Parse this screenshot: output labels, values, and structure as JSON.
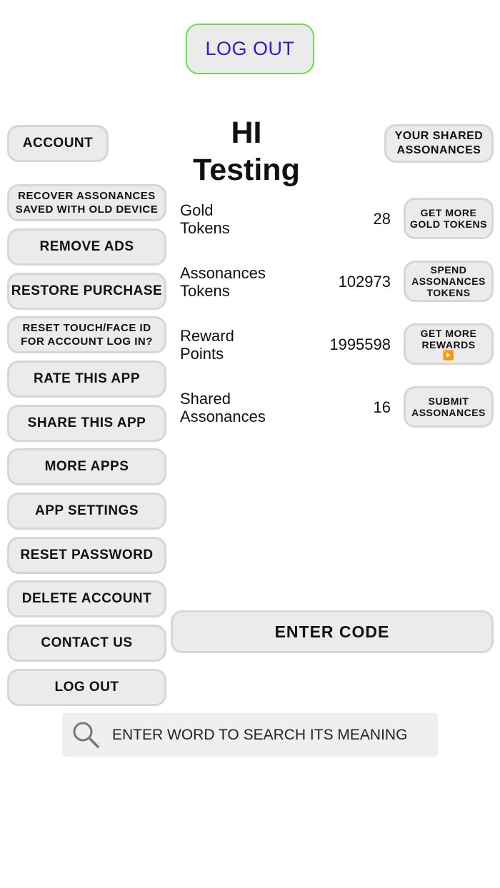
{
  "top_logout_label": "LOG OUT",
  "account_label": "ACCOUNT",
  "greeting": {
    "line1": "HI",
    "line2": "Testing"
  },
  "shared_assonances_button": {
    "line1": "YOUR SHARED",
    "line2": "ASSONANCES"
  },
  "sidebar": {
    "recover": {
      "line1": "RECOVER ASSONANCES",
      "line2": "SAVED WITH OLD DEVICE"
    },
    "remove_ads": "REMOVE ADS",
    "restore_purchase": "RESTORE PURCHASE",
    "reset_touch": {
      "line1": "RESET TOUCH/FACE ID",
      "line2": "FOR ACCOUNT LOG IN?"
    },
    "rate_app": "RATE THIS APP",
    "share_app": "SHARE THIS APP",
    "more_apps": "MORE APPS",
    "app_settings": "APP SETTINGS",
    "reset_password": "RESET PASSWORD",
    "delete_account": "DELETE ACCOUNT",
    "contact_us": "CONTACT US",
    "log_out": "LOG OUT"
  },
  "stats": {
    "gold": {
      "label": "Gold\nTokens",
      "value": "28",
      "btn1": "GET MORE",
      "btn2": "GOLD TOKENS"
    },
    "assonances": {
      "label": "Assonances\nTokens",
      "value": "102973",
      "btn1": "SPEND",
      "btn2": "ASSONANCES",
      "btn3": "TOKENS"
    },
    "reward": {
      "label": "Reward\nPoints",
      "value": "1995598",
      "btn1": "GET MORE",
      "btn2": "REWARDS",
      "btn3": "▶️"
    },
    "shared": {
      "label": "Shared\nAssonances",
      "value": "16",
      "btn1": "SUBMIT",
      "btn2": "ASSONANCES"
    }
  },
  "enter_code_label": "ENTER CODE",
  "search": {
    "placeholder": "ENTER WORD TO SEARCH ITS MEANING",
    "icon": "search-icon"
  }
}
